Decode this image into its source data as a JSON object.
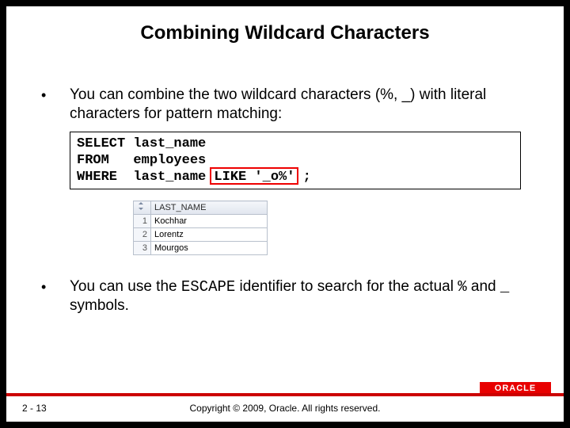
{
  "title": "Combining Wildcard Characters",
  "bullets": {
    "b1": "You can combine the two wildcard characters (%, _) with literal characters for pattern matching:",
    "b2_pre": "You can use the ",
    "b2_escape": "ESCAPE",
    "b2_mid": " identifier to search for the actual ",
    "b2_pct": "%",
    "b2_and": " and ",
    "b2_us": "_",
    "b2_post": " symbols."
  },
  "code": {
    "line1": "SELECT last_name",
    "line2": "FROM   employees",
    "line3": "WHERE  last_name LIKE '_o%' ;"
  },
  "chart_data": {
    "type": "table",
    "columns": [
      "",
      "LAST_NAME"
    ],
    "rows": [
      {
        "idx": "1",
        "name": "Kochhar"
      },
      {
        "idx": "2",
        "name": "Lorentz"
      },
      {
        "idx": "3",
        "name": "Mourgos"
      }
    ]
  },
  "footer": {
    "page": "2 - 13",
    "copyright": "Copyright © 2009, Oracle. All rights reserved.",
    "logo": "ORACLE"
  }
}
